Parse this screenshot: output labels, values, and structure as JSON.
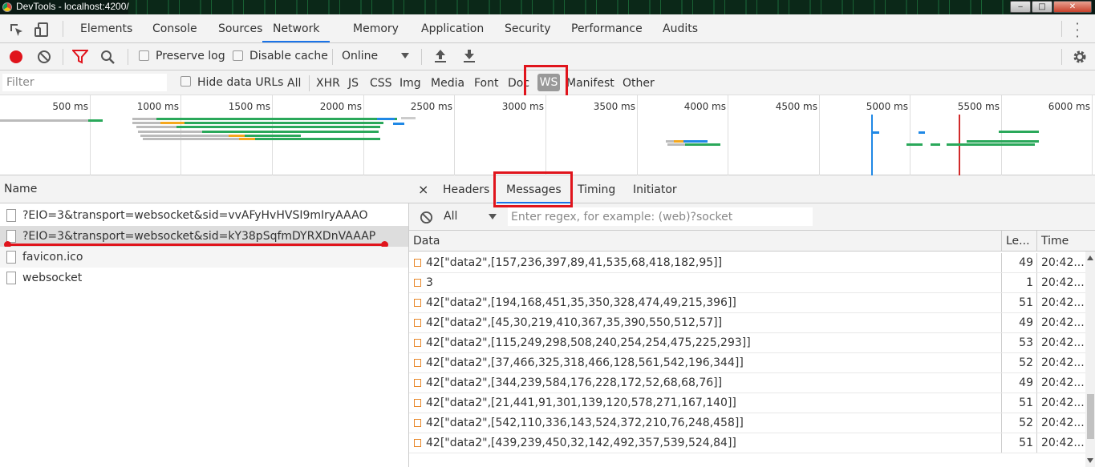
{
  "window": {
    "title": "DevTools - localhost:4200/",
    "min": "‒",
    "max": "□",
    "close": "✕"
  },
  "main_tabs": [
    "Elements",
    "Console",
    "Sources",
    "Network",
    "Memory",
    "Application",
    "Security",
    "Performance",
    "Audits"
  ],
  "active_tab": "Network",
  "toolbar": {
    "preserve_log": "Preserve log",
    "disable_cache": "Disable cache",
    "throttle": "Online"
  },
  "filterbar": {
    "placeholder": "Filter",
    "hide_data_urls": "Hide data URLs",
    "types": [
      "All",
      "XHR",
      "JS",
      "CSS",
      "Img",
      "Media",
      "Font",
      "Doc",
      "WS",
      "Manifest",
      "Other"
    ],
    "active_type": "WS"
  },
  "timeline": {
    "ticks": [
      "500 ms",
      "1000 ms",
      "1500 ms",
      "2000 ms",
      "2500 ms",
      "3000 ms",
      "3500 ms",
      "4000 ms",
      "4500 ms",
      "5000 ms",
      "5500 ms",
      "6000 ms"
    ]
  },
  "requests": {
    "header": "Name",
    "items": [
      "?EIO=3&transport=websocket&sid=vvAFyHvHVSI9mIryAAAO",
      "?EIO=3&transport=websocket&sid=kY38pSqfmDYRXDnVAAAP",
      "favicon.ico",
      "websocket"
    ],
    "selected_index": 1
  },
  "detail_tabs": {
    "close": "×",
    "items": [
      "Headers",
      "Messages",
      "Timing",
      "Initiator"
    ],
    "active": "Messages"
  },
  "messages": {
    "filter_option": "All",
    "regex_placeholder": "Enter regex, for example: (web)?socket",
    "columns": [
      "Data",
      "Le...",
      "Time"
    ],
    "rows": [
      {
        "data": "42[\"data2\",[157,236,397,89,41,535,68,418,182,95]]",
        "length": "49",
        "time": "20:42..."
      },
      {
        "data": "3",
        "length": "1",
        "time": "20:42..."
      },
      {
        "data": "42[\"data2\",[194,168,451,35,350,328,474,49,215,396]]",
        "length": "51",
        "time": "20:42..."
      },
      {
        "data": "42[\"data2\",[45,30,219,410,367,35,390,550,512,57]]",
        "length": "49",
        "time": "20:42..."
      },
      {
        "data": "42[\"data2\",[115,249,298,508,240,254,254,475,225,293]]",
        "length": "53",
        "time": "20:42..."
      },
      {
        "data": "42[\"data2\",[37,466,325,318,466,128,561,542,196,344]]",
        "length": "52",
        "time": "20:42..."
      },
      {
        "data": "42[\"data2\",[344,239,584,176,228,172,52,68,68,76]]",
        "length": "49",
        "time": "20:42..."
      },
      {
        "data": "42[\"data2\",[21,441,91,301,139,120,578,271,167,140]]",
        "length": "51",
        "time": "20:42..."
      },
      {
        "data": "42[\"data2\",[542,110,336,143,524,372,210,76,248,458]]",
        "length": "52",
        "time": "20:42..."
      },
      {
        "data": "42[\"data2\",[439,239,450,32,142,492,357,539,524,84]]",
        "length": "51",
        "time": "20:42..."
      }
    ]
  },
  "colors": {
    "accent": "#1a73e8",
    "highlight_box": "#e0141c",
    "record": "#e0141c",
    "filter_icon": "#e0141c"
  }
}
